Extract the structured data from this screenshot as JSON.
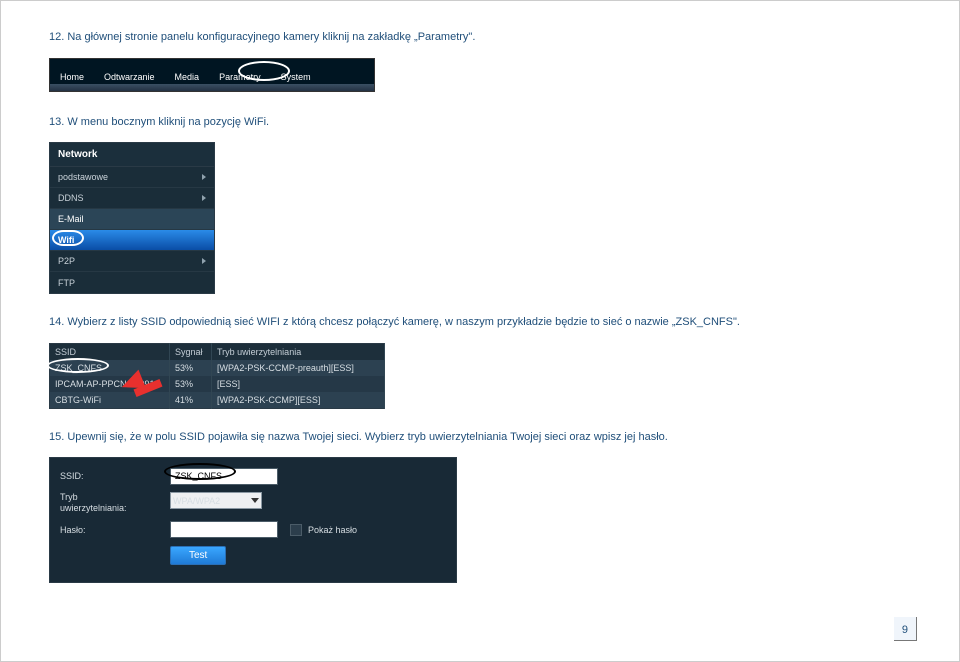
{
  "page_number": "9",
  "steps": {
    "s12": "12. Na głównej stronie panelu konfiguracyjnego kamery kliknij na zakładkę „Parametry\".",
    "s13": "13. W menu bocznym kliknij na pozycję WiFi.",
    "s14": "14. Wybierz z listy SSID odpowiednią sieć WIFI z którą chcesz połączyć kamerę, w naszym przykładzie będzie to sieć o nazwie „ZSK_CNFS\".",
    "s15": "15. Upewnij się, że w polu SSID pojawiła się nazwa Twojej sieci. Wybierz tryb uwierzytelniania Twojej sieci oraz wpisz jej hasło."
  },
  "navbar": {
    "items": [
      "Home",
      "Odtwarzanie",
      "Media",
      "Parametry",
      "System"
    ]
  },
  "sidebar": {
    "header": "Network",
    "items": [
      "podstawowe",
      "DDNS",
      "E-Mail",
      "Wifi",
      "P2P",
      "FTP"
    ]
  },
  "wifi_table": {
    "headers": [
      "SSID",
      "Sygnał",
      "Tryb uwierzytelniania"
    ],
    "rows": [
      {
        "ssid": "ZSK_CNFS",
        "signal": "53%",
        "auth": "[WPA2-PSK-CCMP-preauth][ESS]"
      },
      {
        "ssid": "IPCAM-AP-PPCN-00091",
        "signal": "53%",
        "auth": "[ESS]"
      },
      {
        "ssid": "CBTG-WiFi",
        "signal": "41%",
        "auth": "[WPA2-PSK-CCMP][ESS]"
      }
    ]
  },
  "form": {
    "ssid_label": "SSID:",
    "ssid_value": "ZSK_CNFS",
    "auth_label": "Tryb\nuwierzytelniania:",
    "auth_value": "WPA/WPA2",
    "pass_label": "Hasło:",
    "show_pass": "Pokaż hasło",
    "test_btn": "Test"
  }
}
